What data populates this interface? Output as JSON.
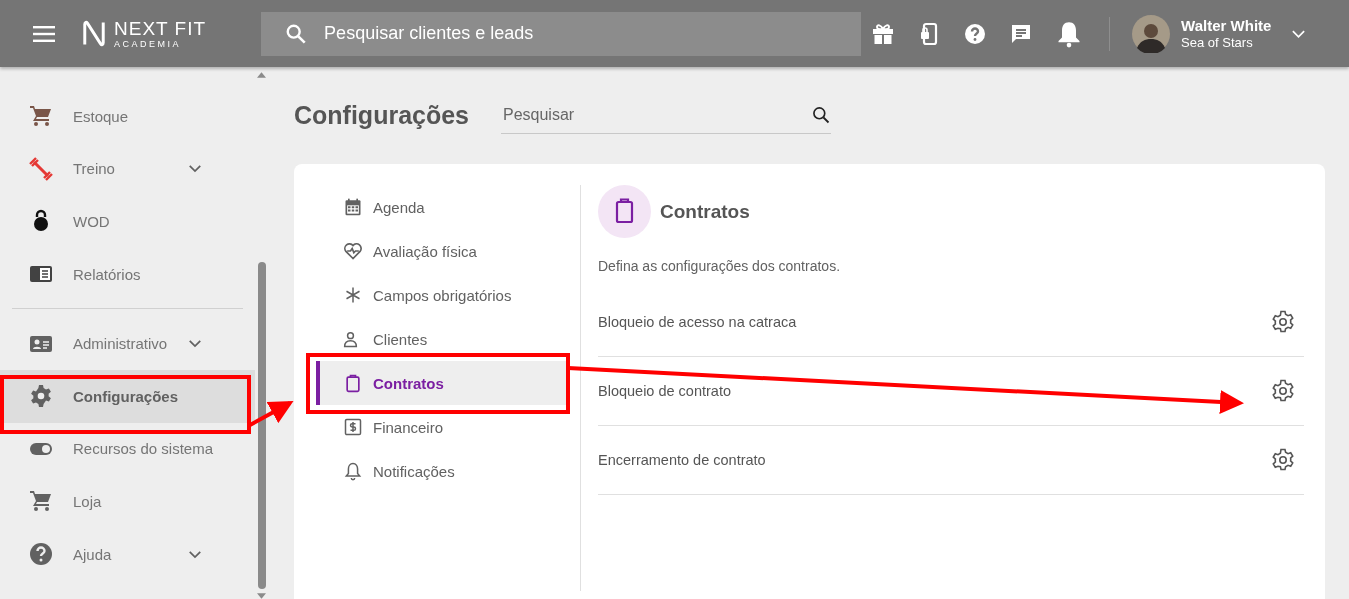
{
  "header": {
    "logo": {
      "title": "NEXT FIT",
      "subtitle": "ACADEMIA"
    },
    "search": {
      "placeholder": "Pesquisar clientes e leads"
    },
    "user": {
      "name": "Walter White",
      "subtitle": "Sea of Stars"
    }
  },
  "sidebar": {
    "sections": [
      [
        {
          "kind": "stock",
          "label": "Estoque",
          "expandable": false,
          "selected": false
        },
        {
          "kind": "training",
          "label": "Treino",
          "expandable": true,
          "selected": false
        },
        {
          "kind": "wod",
          "label": "WOD",
          "expandable": false,
          "selected": false
        },
        {
          "kind": "reports",
          "label": "Relatórios",
          "expandable": false,
          "selected": false
        }
      ],
      [
        {
          "kind": "admin",
          "label": "Administrativo",
          "expandable": true,
          "selected": false
        },
        {
          "kind": "settings",
          "label": "Configurações",
          "expandable": false,
          "selected": true
        },
        {
          "kind": "toggle",
          "label": "Recursos do sistema",
          "expandable": false,
          "selected": false
        },
        {
          "kind": "cart",
          "label": "Loja",
          "expandable": false,
          "selected": false
        },
        {
          "kind": "help",
          "label": "Ajuda",
          "expandable": true,
          "selected": false
        }
      ]
    ]
  },
  "page": {
    "title": "Configurações",
    "search": {
      "placeholder": "Pesquisar"
    },
    "nav": [
      {
        "kind": "calendar",
        "label": "Agenda",
        "selected": false
      },
      {
        "kind": "heart",
        "label": "Avaliação física",
        "selected": false
      },
      {
        "kind": "asterisk",
        "label": "Campos obrigatórios",
        "selected": false
      },
      {
        "kind": "people",
        "label": "Clientes",
        "selected": false
      },
      {
        "kind": "clipboard",
        "label": "Contratos",
        "selected": true
      },
      {
        "kind": "money",
        "label": "Financeiro",
        "selected": false
      },
      {
        "kind": "bell",
        "label": "Notificações",
        "selected": false
      }
    ],
    "panel": {
      "title": "Contratos",
      "description": "Defina as configurações dos contratos.",
      "rows": [
        {
          "label": "Bloqueio de acesso na catraca"
        },
        {
          "label": "Bloqueio de contrato"
        },
        {
          "label": "Encerramento de contrato"
        }
      ]
    }
  }
}
